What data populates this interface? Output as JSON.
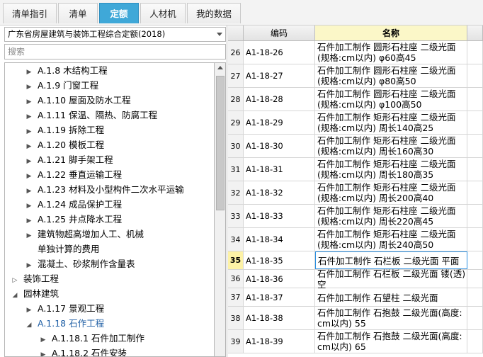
{
  "tabs": [
    {
      "label": "清单指引",
      "active": false
    },
    {
      "label": "清单",
      "active": false
    },
    {
      "label": "定额",
      "active": true
    },
    {
      "label": "人材机",
      "active": false
    },
    {
      "label": "我的数据",
      "active": false
    }
  ],
  "quota_library": "广东省房屋建筑与装饰工程综合定额(2018)",
  "search_placeholder": "搜索",
  "tree": [
    {
      "toggle": "▶",
      "label": "A.1.8 木结构工程"
    },
    {
      "toggle": "▶",
      "label": "A.1.9 门窗工程"
    },
    {
      "toggle": "▶",
      "label": "A.1.10 屋面及防水工程"
    },
    {
      "toggle": "▶",
      "label": "A.1.11 保温、隔热、防腐工程"
    },
    {
      "toggle": "▶",
      "label": "A.1.19 拆除工程"
    },
    {
      "toggle": "▶",
      "label": "A.1.20 模板工程"
    },
    {
      "toggle": "▶",
      "label": "A.1.21 脚手架工程"
    },
    {
      "toggle": "▶",
      "label": "A.1.22 垂直运输工程"
    },
    {
      "toggle": "▶",
      "label": "A.1.23 材料及小型构件二次水平运输"
    },
    {
      "toggle": "▶",
      "label": "A.1.24 成品保护工程"
    },
    {
      "toggle": "▶",
      "label": "A.1.25 井点降水工程"
    },
    {
      "toggle": "▶",
      "label": "建筑物超高增加人工、机械"
    },
    {
      "toggle": "",
      "label": "单独计算的费用"
    },
    {
      "toggle": "▶",
      "label": "混凝土、砂浆制作含量表"
    },
    {
      "toggle": "▷",
      "label": "装饰工程"
    },
    {
      "toggle": "◢",
      "label": "园林建筑"
    },
    {
      "toggle": "▶",
      "label": "A.1.17 景观工程"
    },
    {
      "toggle": "◢",
      "label": "A.1.18 石作工程"
    },
    {
      "toggle": "▶",
      "label": "A.1.18.1 石件加工制作"
    },
    {
      "toggle": "▶",
      "label": "A.1.18.2 石件安装"
    }
  ],
  "grid": {
    "headers": {
      "no": "",
      "code": "编码",
      "name": "名称"
    },
    "rows": [
      {
        "no": "26",
        "code": "A1-18-26",
        "name": "石件加工制作 圆形石柱座 二级光面(规格:cm以内) φ60高45"
      },
      {
        "no": "27",
        "code": "A1-18-27",
        "name": "石件加工制作 圆形石柱座 二级光面(规格:cm以内) φ80高50"
      },
      {
        "no": "28",
        "code": "A1-18-28",
        "name": "石件加工制作 圆形石柱座 二级光面(规格:cm以内) φ100高50"
      },
      {
        "no": "29",
        "code": "A1-18-29",
        "name": "石件加工制作 矩形石柱座 二级光面(规格:cm以内) 周长140高25"
      },
      {
        "no": "30",
        "code": "A1-18-30",
        "name": "石件加工制作 矩形石柱座 二级光面(规格:cm以内) 周长160高30"
      },
      {
        "no": "31",
        "code": "A1-18-31",
        "name": "石件加工制作 矩形石柱座 二级光面(规格:cm以内) 周长180高35"
      },
      {
        "no": "32",
        "code": "A1-18-32",
        "name": "石件加工制作 矩形石柱座 二级光面(规格:cm以内) 周长200高40"
      },
      {
        "no": "33",
        "code": "A1-18-33",
        "name": "石件加工制作 矩形石柱座 二级光面(规格:cm以内) 周长220高45"
      },
      {
        "no": "34",
        "code": "A1-18-34",
        "name": "石件加工制作 矩形石柱座 二级光面(规格:cm以内) 周长240高50"
      },
      {
        "no": "35",
        "code": "A1-18-35",
        "name": "石件加工制作 石栏板 二级光面 平面",
        "selected": true
      },
      {
        "no": "36",
        "code": "A1-18-36",
        "name": "石件加工制作 石栏板 二级光面 镂(透)空"
      },
      {
        "no": "37",
        "code": "A1-18-37",
        "name": "石件加工制作 石望柱 二级光面"
      },
      {
        "no": "38",
        "code": "A1-18-38",
        "name": "石件加工制作 石抱鼓 二级光面(高度:cm以内) 55"
      },
      {
        "no": "39",
        "code": "A1-18-39",
        "name": "石件加工制作 石抱鼓 二级光面(高度:cm以内) 65"
      }
    ]
  }
}
